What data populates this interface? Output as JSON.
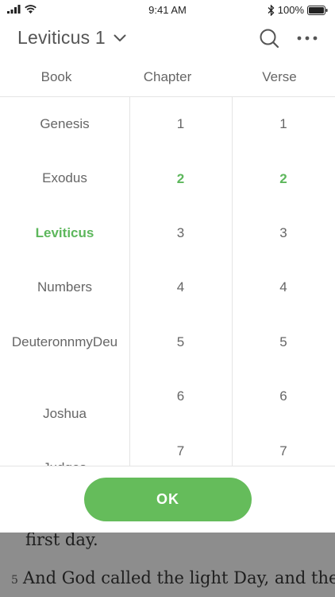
{
  "status_bar": {
    "time": "9:41 AM",
    "battery_percent": "100%"
  },
  "header": {
    "title": "Leviticus 1"
  },
  "columns": {
    "book": "Book",
    "chapter": "Chapter",
    "verse": "Verse"
  },
  "books": [
    "Genesis",
    "Exodus",
    "Leviticus",
    "Numbers",
    "DeuteronnmyDeu",
    "Joshua",
    "Judges"
  ],
  "selected_book": "Leviticus",
  "chapters": [
    "1",
    "2",
    "3",
    "4",
    "5",
    "6",
    "7"
  ],
  "selected_chapter": "2",
  "verses": [
    "1",
    "2",
    "3",
    "4",
    "5",
    "6",
    "7"
  ],
  "selected_verse": "2",
  "ok_button": {
    "label": "OK"
  },
  "background_text": {
    "line1": "first day.",
    "verse_number": "5",
    "line2": "And God called the light Day, and the"
  },
  "colors": {
    "accent": "#65bc5b",
    "selected_text": "#5db75c",
    "overlay": "#8d8d8d"
  }
}
